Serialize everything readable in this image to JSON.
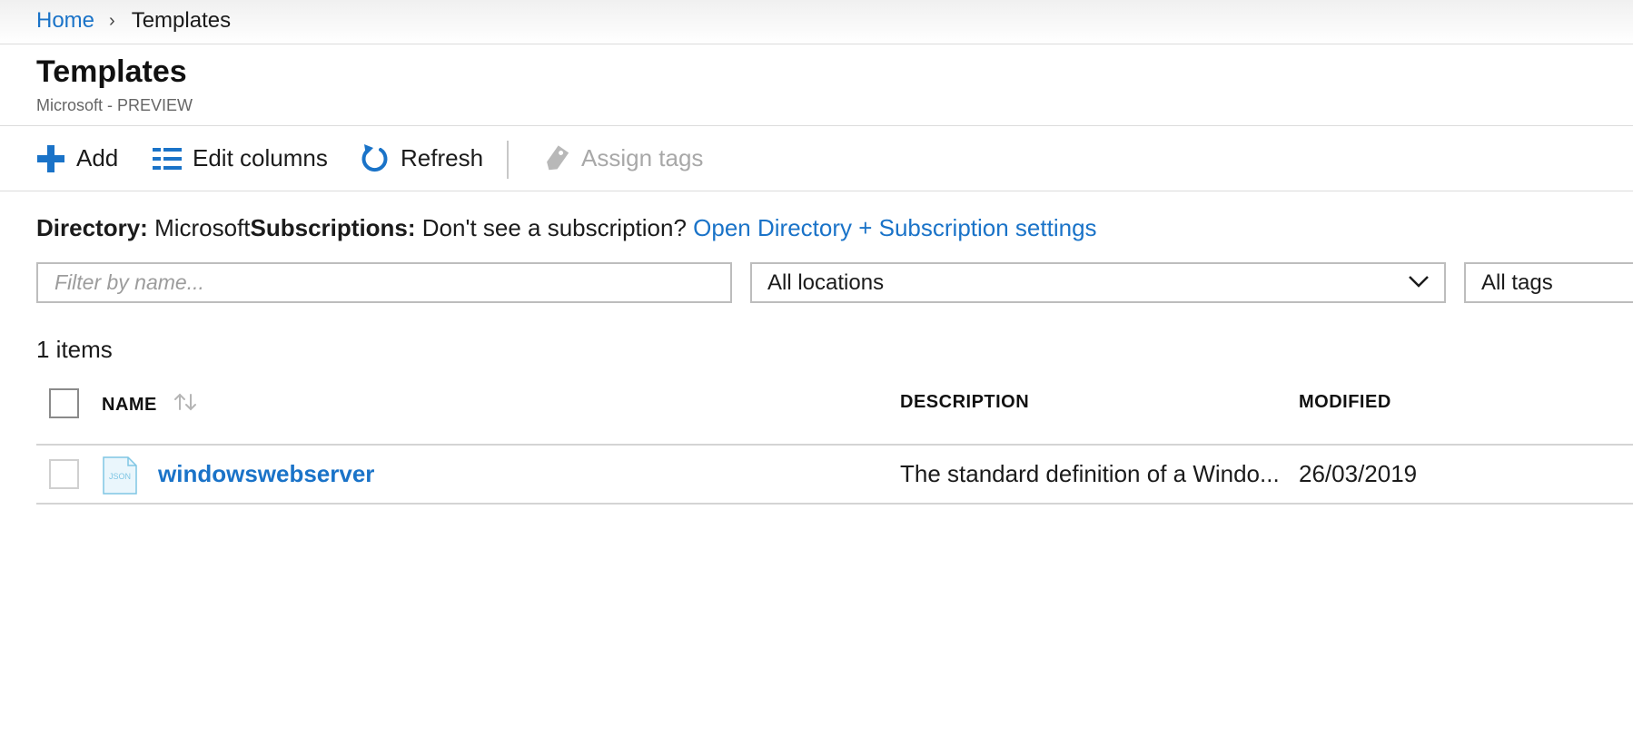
{
  "breadcrumb": {
    "home": "Home",
    "current": "Templates"
  },
  "page": {
    "title": "Templates",
    "subtitle": "Microsoft - PREVIEW"
  },
  "toolbar": {
    "add": "Add",
    "edit_columns": "Edit columns",
    "refresh": "Refresh",
    "assign_tags": "Assign tags"
  },
  "directory": {
    "label": "Directory:",
    "value": "Microsoft",
    "subs_label": "Subscriptions:",
    "subs_text": "Don't see a subscription?",
    "link": "Open Directory + Subscription settings"
  },
  "filters": {
    "name_placeholder": "Filter by name...",
    "locations": "All locations",
    "tags": "All tags"
  },
  "items_count": "1 items",
  "table": {
    "columns": {
      "name": "NAME",
      "description": "DESCRIPTION",
      "modified": "MODIFIED"
    },
    "rows": [
      {
        "file_badge": "JSON",
        "name": "windowswebserver",
        "description": "The standard definition of a Windo...",
        "modified": "26/03/2019"
      }
    ]
  },
  "colors": {
    "accent": "#1a73c8",
    "border": "#bdbdbd",
    "disabled": "#a8a8a8"
  },
  "icons": {
    "add": "plus-icon",
    "edit_columns": "columns-list-icon",
    "refresh": "refresh-icon",
    "assign_tags": "tag-icon",
    "sort": "sort-arrows-icon",
    "file": "json-file-icon",
    "dropdown": "chevron-down-icon",
    "breadcrumb_sep": "chevron-right-icon"
  }
}
